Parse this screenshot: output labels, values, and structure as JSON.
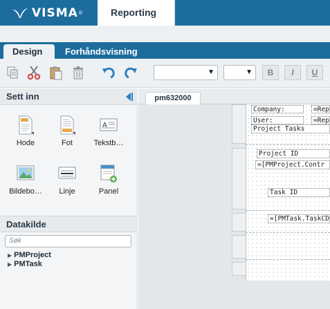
{
  "header": {
    "logo_text": "VISMA",
    "logo_mark": "®",
    "active_tab": "Reporting"
  },
  "modes": {
    "design": "Design",
    "preview": "Forhåndsvisning"
  },
  "toolbar": {
    "icons": [
      "copy-icon",
      "cut-icon",
      "paste-icon",
      "delete-icon",
      "undo-icon",
      "redo-icon"
    ],
    "font_family_value": "",
    "font_size_value": "",
    "bold": "B",
    "italic": "I",
    "underline": "U"
  },
  "insert_panel": {
    "title": "Sett inn",
    "items": [
      {
        "label": "Hode",
        "icon": "header-doc-icon"
      },
      {
        "label": "Fot",
        "icon": "footer-doc-icon"
      },
      {
        "label": "Tekstb…",
        "icon": "textbox-icon"
      },
      {
        "label": "Bildebo…",
        "icon": "image-icon"
      },
      {
        "label": "Linje",
        "icon": "line-icon"
      },
      {
        "label": "Panel",
        "icon": "panel-icon"
      }
    ]
  },
  "datasource_panel": {
    "title": "Datakilde",
    "search_placeholder": "Søk",
    "tree": [
      "PMProject",
      "PMTask"
    ]
  },
  "document": {
    "tab": "pm632000",
    "fields": {
      "company": "Company:",
      "company_val": "=Repo",
      "user": "User:",
      "user_val": "=Repo",
      "project_tasks": "Project Tasks",
      "project_id": "Project ID",
      "project_expr": "=[PMProject.Contr",
      "task_id": "Task ID",
      "task_expr": "=[PMTask.TaskCD"
    }
  },
  "colors": {
    "brand_blue": "#1c6d9e",
    "panel_bg": "#f3f5f6",
    "toolbar_bg": "#eef1f3",
    "undo_blue": "#2f7fc1"
  }
}
